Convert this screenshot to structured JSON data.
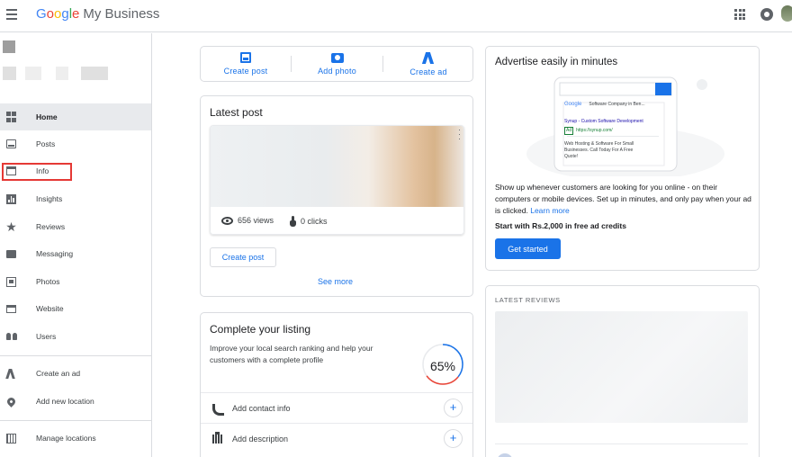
{
  "header": {
    "brand_letters": [
      "G",
      "o",
      "o",
      "g",
      "l",
      "e"
    ],
    "product": "My Business"
  },
  "sidebar": {
    "items": [
      {
        "label": "Home",
        "icon": "dashboard-icon",
        "active": true
      },
      {
        "label": "Posts",
        "icon": "posts-icon"
      },
      {
        "label": "Info",
        "icon": "storefront-icon"
      },
      {
        "label": "Insights",
        "icon": "insights-icon"
      },
      {
        "label": "Reviews",
        "icon": "star-icon"
      },
      {
        "label": "Messaging",
        "icon": "message-icon"
      },
      {
        "label": "Photos",
        "icon": "photos-icon"
      },
      {
        "label": "Website",
        "icon": "website-icon"
      },
      {
        "label": "Users",
        "icon": "users-icon"
      },
      {
        "label": "Create an ad",
        "icon": "google-ads-icon"
      },
      {
        "label": "Add new location",
        "icon": "location-pin-icon"
      },
      {
        "label": "Manage locations",
        "icon": "building-icon"
      }
    ],
    "highlight_color": "#e53935"
  },
  "actions": {
    "create_post": "Create post",
    "add_photo": "Add photo",
    "create_ad": "Create ad"
  },
  "latest_post": {
    "title": "Latest post",
    "views": "656 views",
    "clicks": "0 clicks",
    "create_button": "Create post",
    "see_more": "See more"
  },
  "listing": {
    "title": "Complete your listing",
    "description": "Improve your local search ranking and help your customers with a complete profile",
    "progress_percent": 65,
    "progress_label": "65%",
    "tasks": [
      {
        "label": "Add contact info",
        "icon": "phone-icon"
      },
      {
        "label": "Add description",
        "icon": "description-icon"
      }
    ]
  },
  "advertise": {
    "title": "Advertise easily in minutes",
    "body": "Show up whenever customers are looking for you online - on their computers or mobile devices. Set up in minutes, and only pay when your ad is clicked.",
    "learn_more": "Learn more",
    "credits": "Start with Rs.2,000 in free ad credits",
    "button": "Get started",
    "mock": {
      "search_brand": "Google",
      "search_query": "Software Company in Ben...",
      "ad_title": "Synup - Custom Software Development",
      "ad_badge": "Ad",
      "ad_url": "https://synup.com/",
      "ad_text": "Web Hosting & Software For Small Businesses. Call Today For A Free Quote!"
    }
  },
  "reviews": {
    "label": "LATEST REVIEWS"
  },
  "colors": {
    "accent": "#1a73e8",
    "progress_red": "#ea4335",
    "progress_blue": "#1a73e8"
  }
}
